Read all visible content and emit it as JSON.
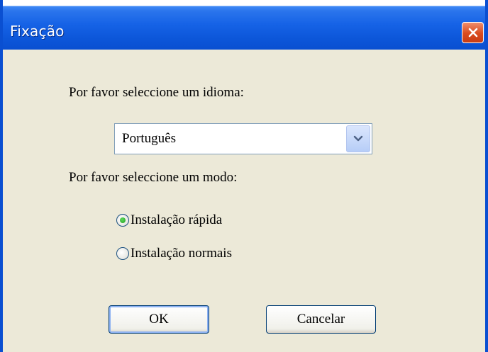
{
  "window": {
    "title": "Fixação",
    "close_icon": "close-x-icon"
  },
  "language": {
    "prompt": "Por favor seleccione um idioma:",
    "selected": "Português",
    "dropdown_icon": "chevron-down-icon"
  },
  "mode": {
    "prompt": "Por favor seleccione um modo:",
    "options": [
      {
        "label": "Instalação rápida",
        "checked": true
      },
      {
        "label": "Instalação normais",
        "checked": false
      }
    ]
  },
  "buttons": {
    "ok_label": "OK",
    "cancel_label": "Cancelar"
  },
  "colors": {
    "titlebar": "#0a5bd8",
    "close_button": "#d94b1e",
    "client_bg": "#ece9d8",
    "radio_dot": "#21a121"
  }
}
